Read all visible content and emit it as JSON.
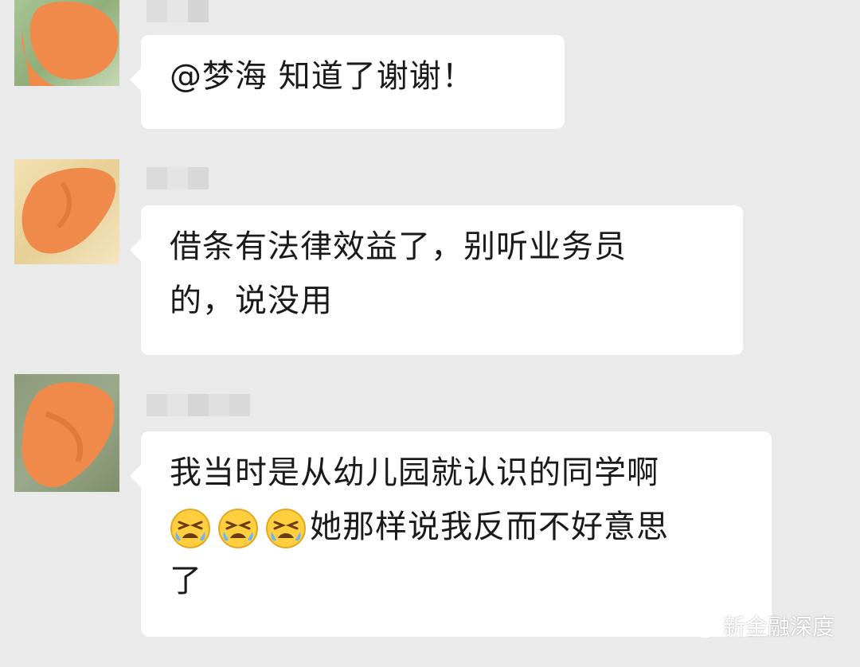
{
  "messages": [
    {
      "text": "@梦海  知道了谢谢！",
      "lines": [
        "@梦海  知道了谢谢！"
      ],
      "emoji_count": 0
    },
    {
      "text": "借条有法律效益了，别听业务员的，说没用",
      "lines": [
        "借条有法律效益了，别听业务员",
        "的，说没用"
      ],
      "emoji_count": 0
    },
    {
      "text": "我当时是从幼儿园就认识的同学啊😫😫😫她那样说我反而不好意思了",
      "lines": [
        "我当时是从幼儿园就认识的同学啊",
        "她那样说我反而不好意思",
        "了"
      ],
      "emoji_count": 3,
      "emoji_name": "tired-face-emoji"
    }
  ],
  "watermark": {
    "text": "新金融深度",
    "icon": "wechat-icon"
  },
  "colors": {
    "background": "#eaeaea",
    "bubble": "#ffffff",
    "avatar_scribble": "#f08a4b",
    "text": "#1a1a1a"
  }
}
